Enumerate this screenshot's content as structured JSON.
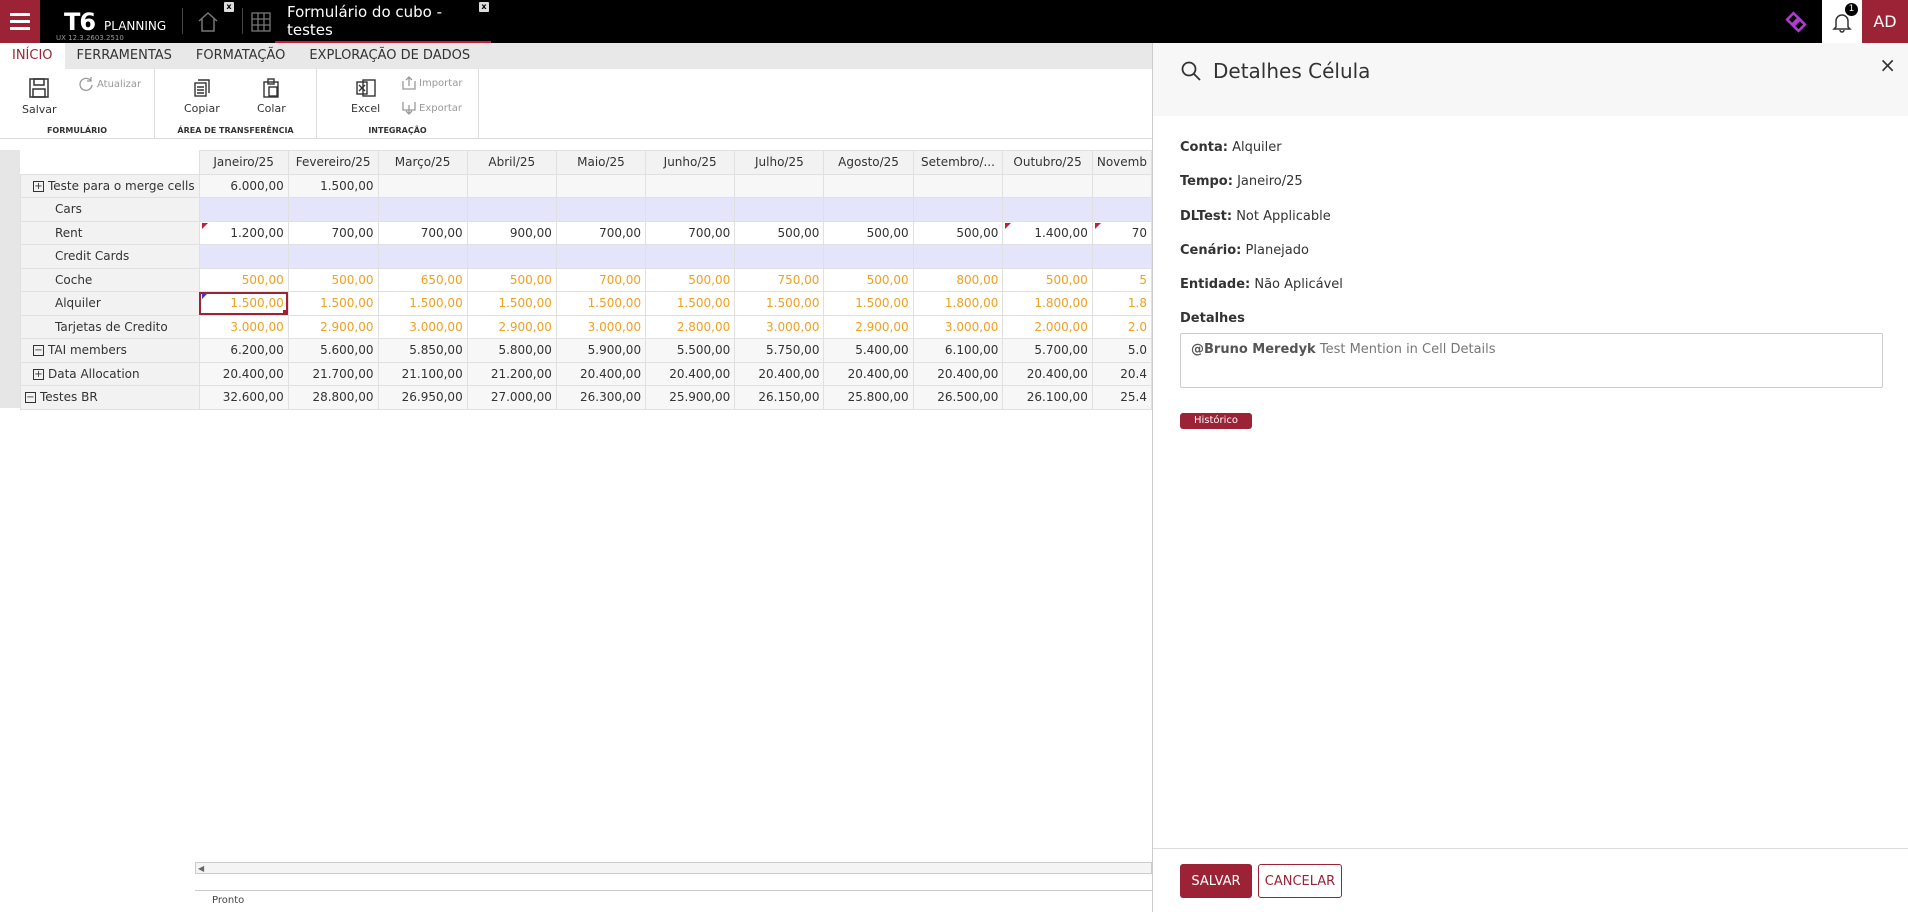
{
  "topbar": {
    "logo_mark": "T6",
    "logo_text": "PLANNING",
    "version": "UX 12.3.2603.2510",
    "active_tab_label": "Formulário do cubo - testes",
    "notification_count": "1",
    "avatar_initials": "AD",
    "close_glyph": "x"
  },
  "ribbon": {
    "tabs": [
      "INÍCIO",
      "FERRAMENTAS",
      "FORMATAÇÃO",
      "EXPLORAÇÃO DE DADOS"
    ],
    "groups": {
      "formulario": {
        "label": "FORMULÁRIO",
        "save": "Salvar",
        "refresh": "Atualizar"
      },
      "clipboard": {
        "label": "ÁREA DE TRANSFERÊNCIA",
        "copy": "Copiar",
        "paste": "Colar"
      },
      "integration": {
        "label": "INTEGRAÇÃO",
        "excel": "Excel",
        "import": "Importar",
        "export": "Exportar"
      }
    }
  },
  "grid": {
    "columns": [
      "Janeiro/25",
      "Fevereiro/25",
      "Março/25",
      "Abril/25",
      "Maio/25",
      "Junho/25",
      "Julho/25",
      "Agosto/25",
      "Setembro/...",
      "Outubro/25",
      "Novemb"
    ],
    "rows": [
      {
        "label": "Teste para o merge cells",
        "expander": "+",
        "values": [
          "6.000,00",
          "1.500,00",
          "",
          "",
          "",
          "",
          "",
          "",
          "",
          "",
          ""
        ]
      },
      {
        "label": "Cars",
        "values": [
          "",
          "",
          "",
          "",
          "",
          "",
          "",
          "",
          "",
          "",
          ""
        ]
      },
      {
        "label": "Rent",
        "values": [
          "1.200,00",
          "700,00",
          "700,00",
          "900,00",
          "700,00",
          "700,00",
          "500,00",
          "500,00",
          "500,00",
          "1.400,00",
          "70"
        ]
      },
      {
        "label": "Credit Cards",
        "values": [
          "",
          "",
          "",
          "",
          "",
          "",
          "",
          "",
          "",
          "",
          ""
        ]
      },
      {
        "label": "Coche",
        "values": [
          "500,00",
          "500,00",
          "650,00",
          "500,00",
          "700,00",
          "500,00",
          "750,00",
          "500,00",
          "800,00",
          "500,00",
          "5"
        ]
      },
      {
        "label": "Alquiler",
        "values": [
          "1.500,00",
          "1.500,00",
          "1.500,00",
          "1.500,00",
          "1.500,00",
          "1.500,00",
          "1.500,00",
          "1.500,00",
          "1.800,00",
          "1.800,00",
          "1.8"
        ]
      },
      {
        "label": "Tarjetas de Credito",
        "values": [
          "3.000,00",
          "2.900,00",
          "3.000,00",
          "2.900,00",
          "3.000,00",
          "2.800,00",
          "3.000,00",
          "2.900,00",
          "3.000,00",
          "2.000,00",
          "2.0"
        ]
      },
      {
        "label": "TAI members",
        "expander": "−",
        "values": [
          "6.200,00",
          "5.600,00",
          "5.850,00",
          "5.800,00",
          "5.900,00",
          "5.500,00",
          "5.750,00",
          "5.400,00",
          "6.100,00",
          "5.700,00",
          "5.0"
        ]
      },
      {
        "label": "Data Allocation",
        "expander": "+",
        "values": [
          "20.400,00",
          "21.700,00",
          "21.100,00",
          "21.200,00",
          "20.400,00",
          "20.400,00",
          "20.400,00",
          "20.400,00",
          "20.400,00",
          "20.400,00",
          "20.4"
        ]
      },
      {
        "label": "Testes BR",
        "expander": "−",
        "values": [
          "32.600,00",
          "28.800,00",
          "26.950,00",
          "27.000,00",
          "26.300,00",
          "25.900,00",
          "26.150,00",
          "25.800,00",
          "26.500,00",
          "26.100,00",
          "25.4"
        ]
      }
    ],
    "status": "Pronto"
  },
  "panel": {
    "title": "Detalhes Célula",
    "close_glyph": "×",
    "fields": [
      {
        "label": "Conta:",
        "value": "Alquiler"
      },
      {
        "label": "Tempo:",
        "value": "Janeiro/25"
      },
      {
        "label": "DLTest:",
        "value": "Not Applicable"
      },
      {
        "label": "Cenário:",
        "value": "Planejado"
      },
      {
        "label": "Entidade:",
        "value": "Não Aplicável"
      }
    ],
    "details_label": "Detalhes",
    "details_mention": "@Bruno Meredyk",
    "details_text": "Test Mention in Cell Details",
    "history_button": "Histórico",
    "save_button": "SALVAR",
    "cancel_button": "CANCELAR"
  },
  "colors": {
    "brand": "#9b2335",
    "accent_red": "#c41e3a",
    "editable_value": "#f0a020",
    "blank_row": "#e4e4fa"
  }
}
